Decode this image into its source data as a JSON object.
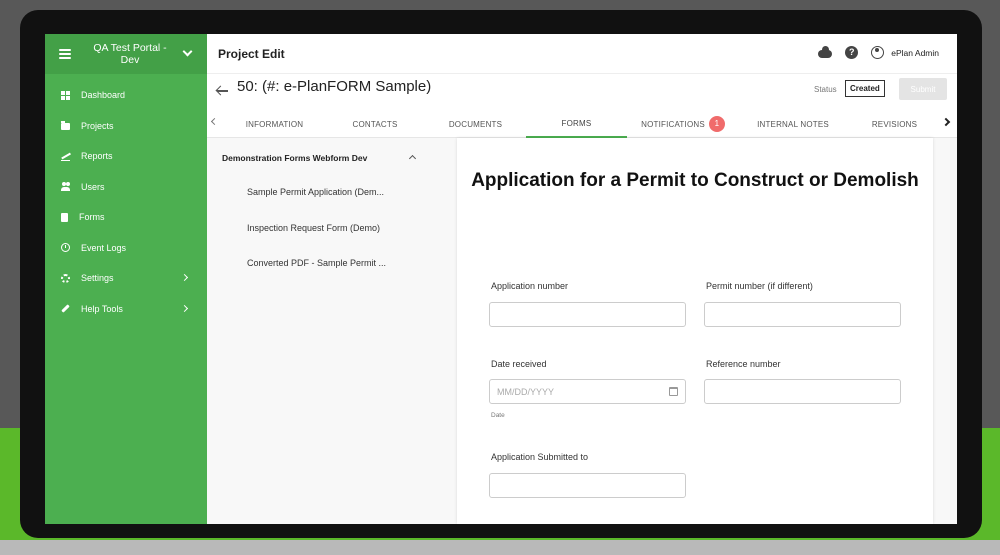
{
  "sidebar": {
    "portal_title": "QA Test Portal - Dev",
    "items": [
      {
        "label": "Dashboard",
        "icon": "dashboard-icon"
      },
      {
        "label": "Projects",
        "icon": "folder-icon"
      },
      {
        "label": "Reports",
        "icon": "chart-icon"
      },
      {
        "label": "Users",
        "icon": "users-icon"
      },
      {
        "label": "Forms",
        "icon": "document-icon"
      },
      {
        "label": "Event Logs",
        "icon": "clock-icon"
      },
      {
        "label": "Settings",
        "icon": "gear-icon"
      },
      {
        "label": "Help Tools",
        "icon": "wrench-icon"
      }
    ]
  },
  "topbar": {
    "title": "Project Edit",
    "user": "ePlan Admin"
  },
  "project": {
    "title": "50: (#: e-PlanFORM Sample)",
    "status_label": "Status",
    "status_value": "Created",
    "submit_label": "Submit"
  },
  "tabs": [
    {
      "label": "INFORMATION"
    },
    {
      "label": "CONTACTS"
    },
    {
      "label": "DOCUMENTS"
    },
    {
      "label": "FORMS",
      "active": true
    },
    {
      "label": "NOTIFICATIONS",
      "badge": "1"
    },
    {
      "label": "INTERNAL NOTES"
    },
    {
      "label": "REVISIONS"
    }
  ],
  "forms_panel": {
    "group": "Demonstration Forms Webform Dev",
    "items": [
      "Sample Permit Application (Dem...",
      "Inspection Request Form (Demo)",
      "Converted PDF - Sample Permit ..."
    ]
  },
  "form": {
    "heading": "Application for a Permit to Construct or Demolish",
    "fields": {
      "application_number": {
        "label": "Application number",
        "value": ""
      },
      "permit_number": {
        "label": "Permit number (if different)",
        "value": ""
      },
      "date_received": {
        "label": "Date received",
        "placeholder": "MM/DD/YYYY",
        "help": "Date"
      },
      "reference_number": {
        "label": "Reference number",
        "value": ""
      },
      "submitted_to": {
        "label": "Application Submitted to",
        "value": ""
      }
    }
  },
  "colors": {
    "accent": "#4caf50",
    "badge": "#f06b6b",
    "outer_green": "#5bb82a"
  }
}
